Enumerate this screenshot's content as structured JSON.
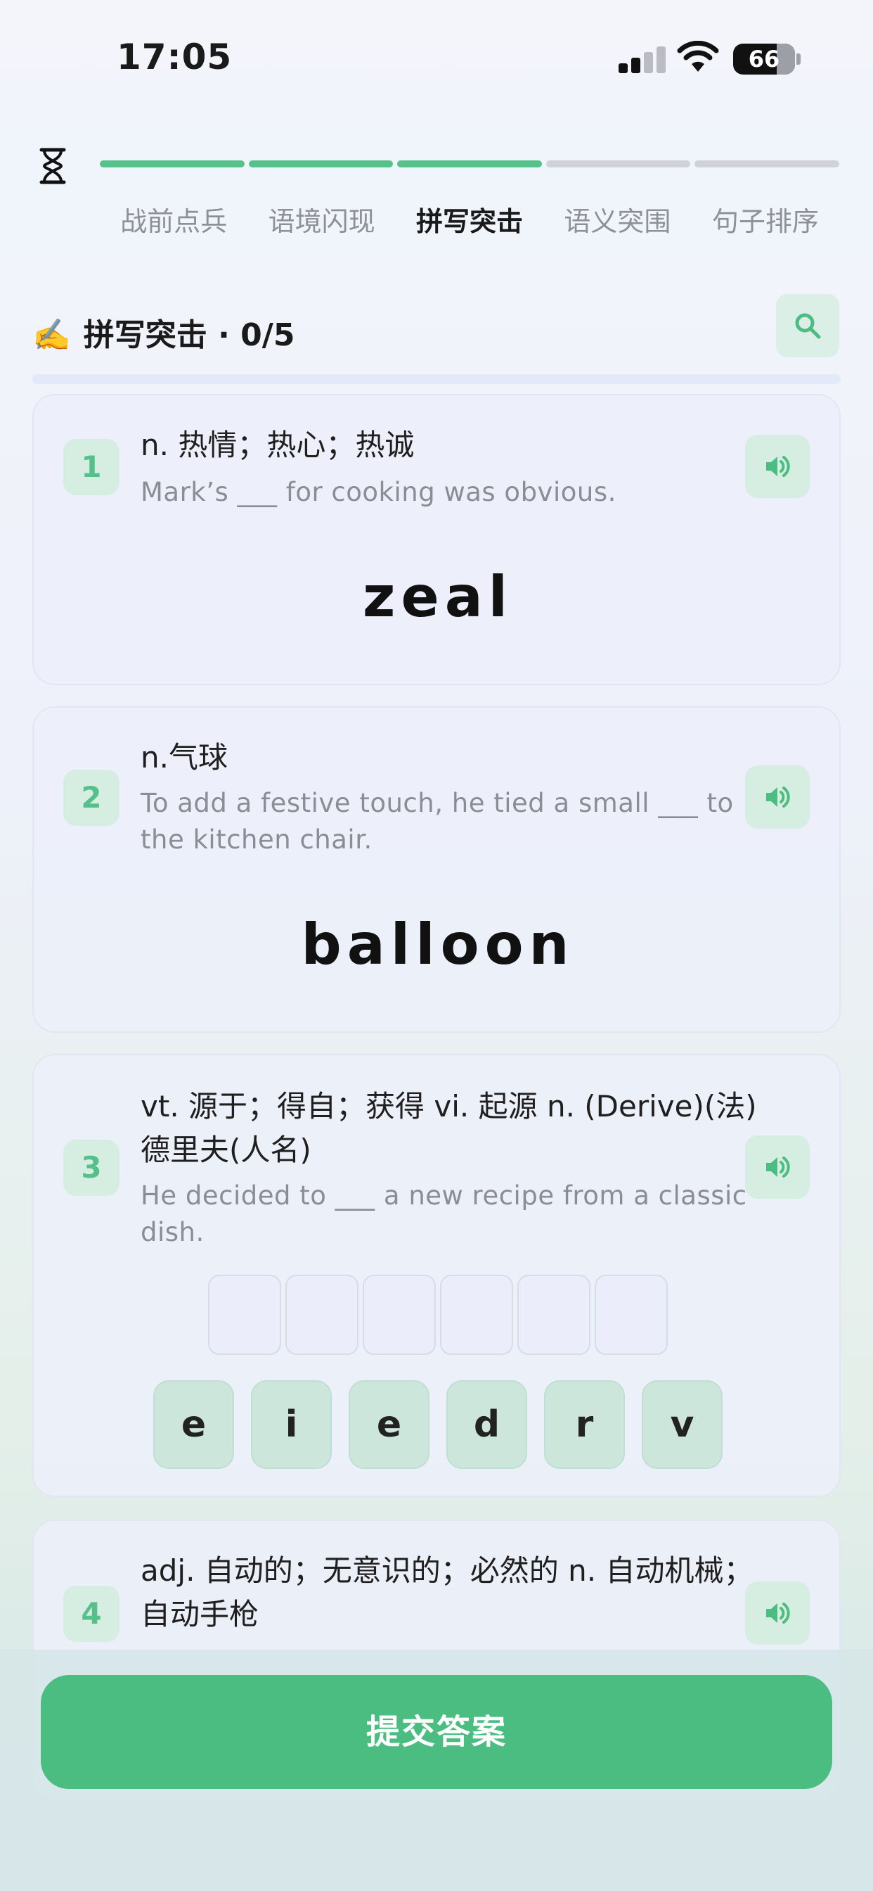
{
  "status_bar": {
    "time": "17:05",
    "battery": "66"
  },
  "progress": {
    "completed_segments": 3,
    "total_segments": 5,
    "steps": [
      "战前点兵",
      "语境闪现",
      "拼写突击",
      "语义突围",
      "句子排序"
    ],
    "active_step": "拼写突击"
  },
  "section": {
    "emoji": "✍️",
    "title": "拼写突击 · 0/5"
  },
  "cards": [
    {
      "number": "1",
      "meaning": "n. 热情；热心；热诚",
      "example": "Mark’s ___ for cooking was obvious.",
      "answer": "zeal"
    },
    {
      "number": "2",
      "meaning": "n.气球",
      "example": "To add a festive touch, he tied a small ___ to the kitchen chair.",
      "answer": "balloon"
    },
    {
      "number": "3",
      "meaning": "vt. 源于；得自；获得 vi. 起源 n. (Derive)(法)德里夫(人名)",
      "example": "He decided to ___ a new recipe from a classic dish.",
      "slots": 6,
      "letters": [
        "e",
        "i",
        "e",
        "d",
        "r",
        "v"
      ]
    },
    {
      "number": "4",
      "meaning": "adj. 自动的；无意识的；必然的 n. 自动机械；自动手枪"
    }
  ],
  "submit": {
    "label": "提交答案"
  },
  "colors": {
    "accent": "#4bbd80",
    "badge_bg": "#d6ede2",
    "card_bg": "#eceffa"
  }
}
